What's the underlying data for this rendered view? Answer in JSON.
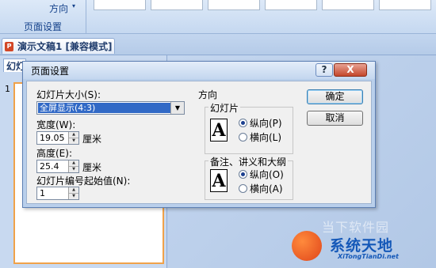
{
  "ribbon": {
    "direction_label": "方向",
    "direction_caret": "▾",
    "group_label": "页面设置"
  },
  "doc_tab": {
    "label": "演示文稿1 [兼容模式]",
    "icon": "powerpoint-icon"
  },
  "slide_pane": {
    "tab_label": "幻灯片",
    "slide_number": "1"
  },
  "dialog": {
    "title": "页面设置",
    "help_glyph": "?",
    "close_glyph": "X",
    "slide_size_label": "幻灯片大小(S):",
    "slide_size_value": "全屏显示(4:3)",
    "width_label": "宽度(W):",
    "width_value": "19.05",
    "width_unit": "厘米",
    "height_label": "高度(E):",
    "height_value": "25.4",
    "height_unit": "厘米",
    "start_number_label": "幻灯片编号起始值(N):",
    "start_number_value": "1",
    "orientation_title": "方向",
    "slides_group": "幻灯片",
    "slides_portrait": "纵向(P)",
    "slides_landscape": "横向(L)",
    "notes_group": "备注、讲义和大纲",
    "notes_portrait": "纵向(O)",
    "notes_landscape": "横向(A)",
    "icon_glyph": "A",
    "ok_label": "确定",
    "cancel_label": "取消"
  },
  "watermark": {
    "ghost": "当下软件园",
    "title": "系统天地",
    "url": "XiTongTianDi.net"
  },
  "colors": {
    "selection": "#3169c6",
    "close": "#c4472c",
    "accent": "#1458b8"
  }
}
